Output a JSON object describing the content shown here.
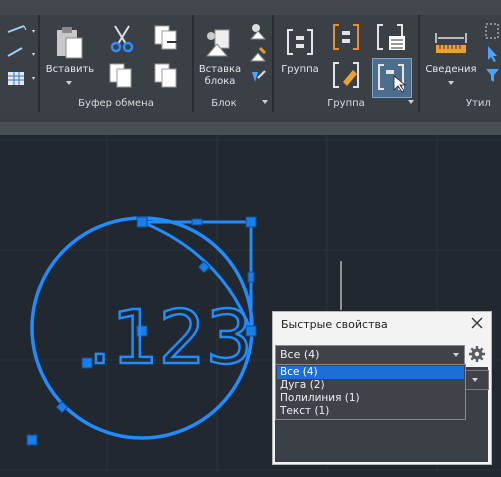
{
  "ribbon": {
    "panels": {
      "clipboard": {
        "title": "Буфер обмена",
        "paste_label": "Вставить"
      },
      "block": {
        "title": "Блок",
        "insert_label_line1": "Вставка",
        "insert_label_line2": "блока"
      },
      "group": {
        "title": "Группа",
        "group_label": "Группа"
      },
      "utilities": {
        "title": "Утил",
        "measure_label": "Сведения"
      }
    }
  },
  "quick_properties": {
    "title": "Быстрые свойства",
    "selected": "Все (4)",
    "options": [
      "Все (4)",
      "Дуга (2)",
      "Полилиния (1)",
      "Текст (1)"
    ]
  },
  "drawing": {
    "text": ".123",
    "accent": "#1f8cff"
  }
}
